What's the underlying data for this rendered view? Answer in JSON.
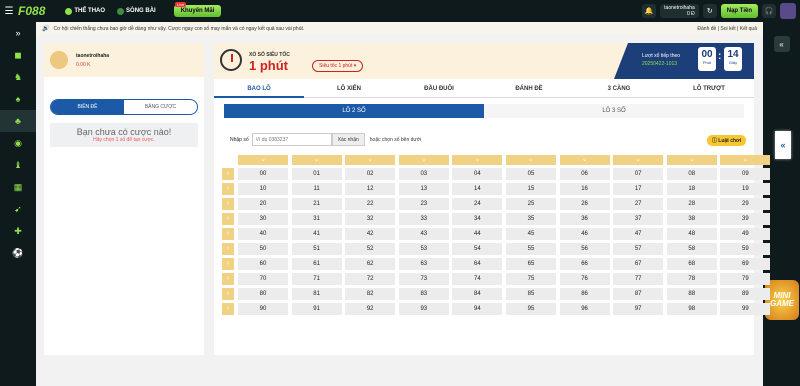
{
  "topbar": {
    "logo_a": "F0",
    "logo_b": "88",
    "nav": [
      "THỂ THAO",
      "SÒNG BÀI"
    ],
    "live_badge": "Live",
    "promo": "Khuyến Mãi",
    "account_name": "taonetroihaha",
    "account_balance": "0 Đ",
    "deposit": "Nạp Tiền"
  },
  "marquee": {
    "text": "Cơ hội chiến thắng chưa bao giờ dễ dàng như vậy. Cược ngay con số may mắn và có ngay kết quả sau vài phút.",
    "links": "Đánh đề | Soi kết | Kết quả"
  },
  "user": {
    "name": "taonetroihaha",
    "balance": "0.00 K"
  },
  "left_tabs": [
    "BIÊN ĐỀ",
    "BẢNG CƯỢC"
  ],
  "empty": {
    "title": "Bạn chưa có cược nào!",
    "sub": "Hãy chọn 1 số để tạo cược."
  },
  "header": {
    "sub": "XỔ SỐ SIÊU TỐC",
    "main": "1 phút",
    "speed": "Siêu tốc 1 phút ▾",
    "next_label": "Lượt xổ tiếp theo",
    "draw_id": "20250422-1013",
    "minutes": "00",
    "minutes_label": "Phút",
    "seconds": "14",
    "seconds_label": "Giây"
  },
  "categories": [
    "BAO LÔ",
    "LÔ XIÊN",
    "ĐẦU ĐUÔI",
    "ĐÁNH ĐỀ",
    "3 CÀNG",
    "LÔ TRƯỢT"
  ],
  "subtabs": [
    "LÔ 2 SỐ",
    "LÔ 3 SỐ"
  ],
  "input": {
    "label": "Nhập số",
    "placeholder": "Ví dụ 0383237",
    "confirm": "Xác nhận",
    "or": "hoặc chọn số bên dưới"
  },
  "rules": "Luật chơi",
  "minigame": "MINI GAME",
  "numbers": [
    [
      "00",
      "01",
      "02",
      "03",
      "04",
      "05",
      "06",
      "07",
      "08",
      "09"
    ],
    [
      "10",
      "11",
      "12",
      "13",
      "14",
      "15",
      "16",
      "17",
      "18",
      "19"
    ],
    [
      "20",
      "21",
      "22",
      "23",
      "24",
      "25",
      "26",
      "27",
      "28",
      "29"
    ],
    [
      "30",
      "31",
      "32",
      "33",
      "34",
      "35",
      "36",
      "37",
      "38",
      "39"
    ],
    [
      "40",
      "41",
      "42",
      "43",
      "44",
      "45",
      "46",
      "47",
      "48",
      "49"
    ],
    [
      "50",
      "51",
      "52",
      "53",
      "54",
      "55",
      "56",
      "57",
      "58",
      "59"
    ],
    [
      "60",
      "61",
      "62",
      "63",
      "64",
      "65",
      "66",
      "67",
      "68",
      "69"
    ],
    [
      "70",
      "71",
      "72",
      "73",
      "74",
      "75",
      "76",
      "77",
      "78",
      "79"
    ],
    [
      "80",
      "81",
      "82",
      "83",
      "84",
      "85",
      "86",
      "87",
      "88",
      "89"
    ],
    [
      "90",
      "91",
      "92",
      "93",
      "94",
      "95",
      "96",
      "97",
      "98",
      "99"
    ]
  ]
}
